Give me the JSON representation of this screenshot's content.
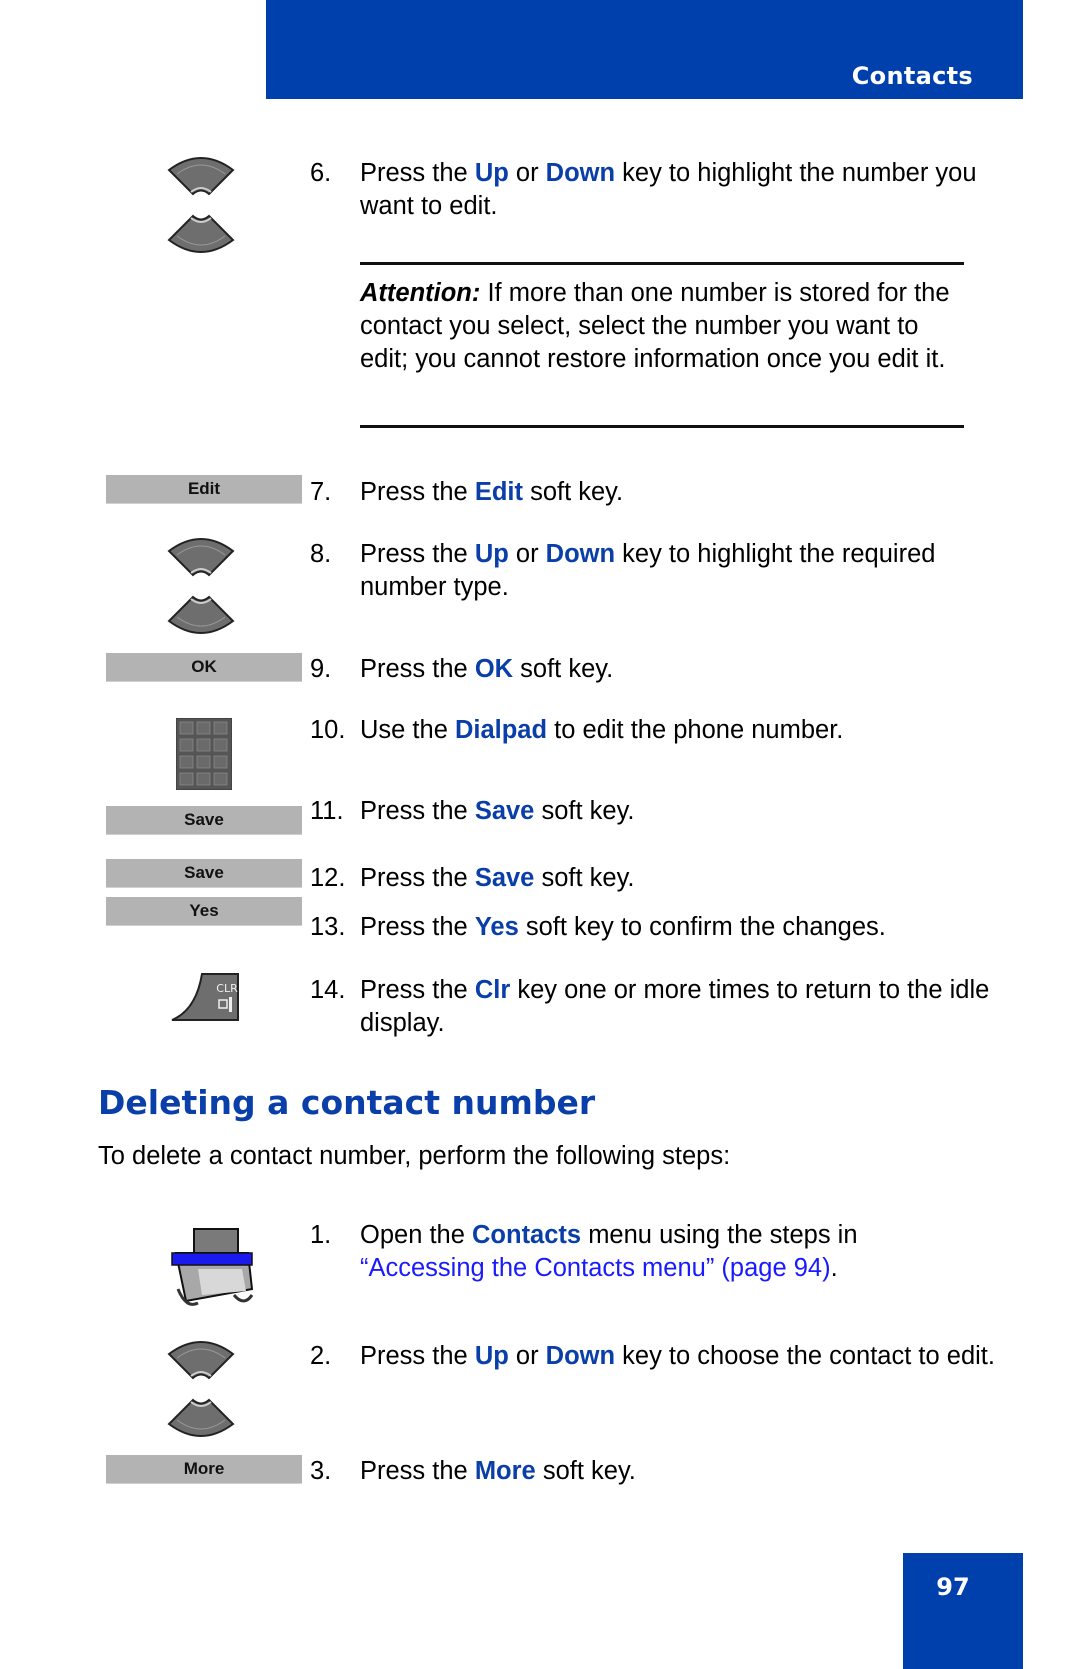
{
  "header": {
    "section_title": "Contacts"
  },
  "footer": {
    "page_number": "97"
  },
  "colors": {
    "brand_blue": "#0040ad",
    "keyword_blue": "#0a3ea8",
    "link_blue": "#1a1aff",
    "softkey_gray": "#b3b3b3"
  },
  "edit_steps": [
    {
      "num": "6.",
      "icon": "up-down-navigation-keys-icon",
      "parts": [
        "Press the ",
        "Up",
        " or ",
        "Down",
        " key to highlight the number you want to edit."
      ]
    },
    {
      "num": "7.",
      "softkey": "Edit",
      "parts": [
        "Press the ",
        "Edit",
        " soft key."
      ]
    },
    {
      "num": "8.",
      "icon": "up-down-navigation-keys-icon",
      "parts": [
        "Press the ",
        "Up",
        " or ",
        "Down",
        " key to highlight the required number type."
      ]
    },
    {
      "num": "9.",
      "softkey": "OK",
      "parts": [
        "Press the ",
        "OK",
        " soft key."
      ]
    },
    {
      "num": "10.",
      "icon": "dialpad-icon",
      "parts": [
        "Use the ",
        "Dialpad",
        " to edit the phone number."
      ]
    },
    {
      "num": "11.",
      "softkey": "Save",
      "parts": [
        "Press the ",
        "Save",
        " soft key."
      ]
    },
    {
      "num": "12.",
      "softkey": "Save",
      "parts": [
        "Press the ",
        "Save",
        " soft key."
      ]
    },
    {
      "num": "13.",
      "softkey": "Yes",
      "parts": [
        "Press the ",
        "Yes",
        " soft key to confirm the changes."
      ]
    },
    {
      "num": "14.",
      "icon": "clr-key-icon",
      "parts": [
        "Press the ",
        "Clr",
        " key one or more times to return to the idle display."
      ]
    }
  ],
  "attention": {
    "label": "Attention:",
    "text": " If more than one number is stored for the contact you select, select the number you want to edit; you cannot restore information once you edit it."
  },
  "delete_section": {
    "heading": "Deleting a contact number",
    "intro": "To delete a contact number, perform the following steps:",
    "steps": [
      {
        "num": "1.",
        "icon": "contacts-menu-icon",
        "parts": [
          "Open the ",
          "Contacts",
          " menu using the steps in "
        ],
        "link": "“Accessing the Contacts menu” (page 94)",
        "after": "."
      },
      {
        "num": "2.",
        "icon": "up-down-navigation-keys-icon",
        "parts": [
          "Press the ",
          "Up",
          " or ",
          "Down",
          " key to choose the contact to edit."
        ]
      },
      {
        "num": "3.",
        "softkey": "More",
        "parts": [
          "Press the ",
          "More",
          " soft key."
        ]
      }
    ]
  },
  "softkeys": {
    "edit": "Edit",
    "ok": "OK",
    "save1": "Save",
    "save2": "Save",
    "yes": "Yes",
    "more": "More"
  },
  "clr_label": "CLR"
}
